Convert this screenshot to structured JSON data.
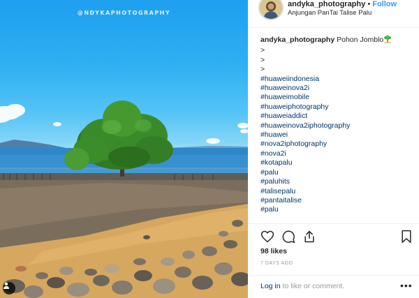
{
  "photo": {
    "watermark": "@NDYKAPHOTOGRAPHY",
    "user_tag_icon": "user-tag-icon"
  },
  "header": {
    "username": "andyka_photography",
    "separator": "•",
    "follow_label": "Follow",
    "location": "Anjungan PanTai Talise Palu"
  },
  "caption": {
    "username": "andyka_photography",
    "text": "Pohon Jomblo",
    "emoji_icon": "palm-tree-emoji",
    "lines": [
      ">",
      ">",
      ">"
    ],
    "hashtags": [
      "#huaweiindonesia",
      "#huaweinova2i",
      "#huaweimobile",
      "#huaweiphotography",
      "#huaweiaddict",
      "#huaweinova2iphotography",
      "#huawei",
      "#nova2iphotography",
      "#nova2i",
      "#kotapalu",
      "#palu",
      "#paluhits",
      "#talisepalu",
      "#pantaitalise",
      "#palu"
    ]
  },
  "actions": {
    "like_icon": "heart-icon",
    "comment_icon": "comment-icon",
    "share_icon": "share-icon",
    "save_icon": "bookmark-icon"
  },
  "likes": "98 likes",
  "time_ago": "7 DAYS AGO",
  "footer": {
    "login_label": "Log in",
    "rest_text": " to like or comment.",
    "more_label": "•••"
  },
  "colors": {
    "link": "#003569",
    "follow": "#3897f0",
    "text": "#262626",
    "muted": "#999999"
  }
}
